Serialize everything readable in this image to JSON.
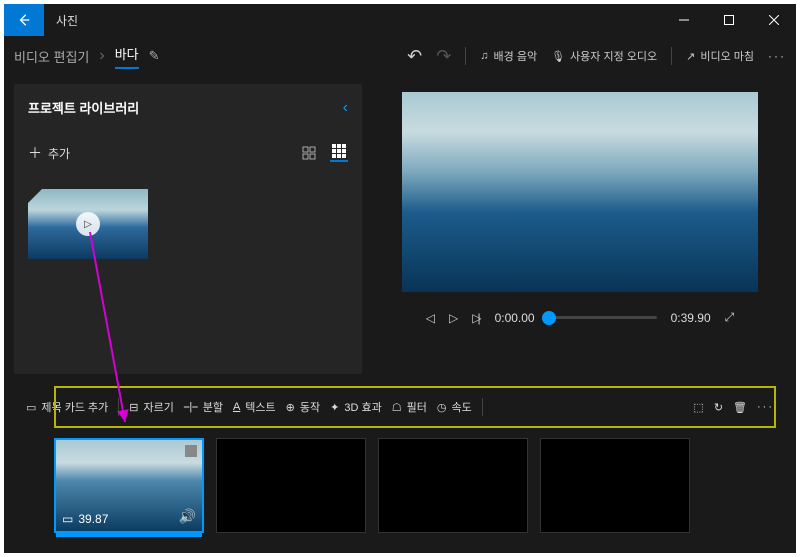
{
  "titlebar": {
    "app_name": "사진"
  },
  "breadcrumb": {
    "editor": "비디오 편집기",
    "project": "바다"
  },
  "topbar": {
    "undo": "↶",
    "redo": "↷",
    "bg_music": "배경 음악",
    "custom_audio": "사용자 지정 오디오",
    "finish": "비디오 마침"
  },
  "library": {
    "title": "프로젝트 라이브러리",
    "add_label": "추가"
  },
  "player": {
    "current": "0:00.00",
    "total": "0:39.90"
  },
  "toolbar": {
    "title_card": "제목 카드 추가",
    "trim": "자르기",
    "split": "분할",
    "text": "텍스트",
    "motion": "동작",
    "effects3d": "3D 효과",
    "filter": "필터",
    "speed": "속도"
  },
  "clip": {
    "duration": "39.87"
  }
}
